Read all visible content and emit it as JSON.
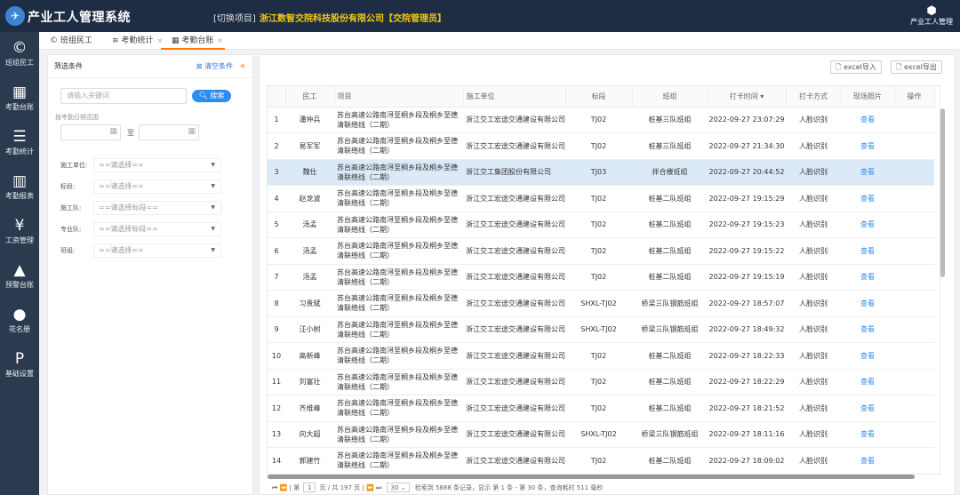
{
  "header": {
    "app_title": "产业工人管理系统",
    "switch_project": "[切换项目]",
    "company": "浙江数智交院科技股份有限公司【交院管理员】",
    "user_label": "产业工人管理"
  },
  "sidebar": {
    "items": [
      {
        "icon": "©",
        "label": "班组民工"
      },
      {
        "icon": "▦",
        "label": "考勤台账"
      },
      {
        "icon": "☰",
        "label": "考勤统计"
      },
      {
        "icon": "▥",
        "label": "考勤报表"
      },
      {
        "icon": "¥",
        "label": "工资管理"
      },
      {
        "icon": "▲",
        "label": "预警台账"
      },
      {
        "icon": "●",
        "label": "花名册"
      },
      {
        "icon": "P",
        "label": "基础设置"
      }
    ]
  },
  "tabs": [
    {
      "icon": "©",
      "label": "班组民工"
    },
    {
      "icon": "≡",
      "label": "考勤统计"
    },
    {
      "icon": "▦",
      "label": "考勤台账"
    }
  ],
  "filter": {
    "title": "筛选条件",
    "clear_label": "清空条件",
    "collapse_icon": "«",
    "keyword_placeholder": "请输入关键词",
    "search_label": "搜索",
    "date_range_label": "按考勤日期范围",
    "to_label": "至",
    "rows": [
      {
        "label": "施工单位:",
        "value": "==请选择=="
      },
      {
        "label": "标段:",
        "value": "==请选择=="
      },
      {
        "label": "施工队:",
        "value": "==请选择标段=="
      },
      {
        "label": "专业队:",
        "value": "==请选择标段=="
      },
      {
        "label": "班组:",
        "value": "==请选择=="
      }
    ]
  },
  "toolbar": {
    "import_label": "excel导入",
    "export_label": "excel导出"
  },
  "table": {
    "headers": [
      "",
      "民工",
      "项目",
      "施工单位",
      "标段",
      "班组",
      "打卡时间 ▾",
      "打卡方式",
      "现场照片",
      "操作"
    ],
    "rows": [
      {
        "no": "1",
        "name": "潘仲兵",
        "project": "苏台高速公路南浔至桐乡段及桐乡至德清联络线（二期）",
        "unit": "浙江交工宏途交通建设有限公司",
        "section": "TJ02",
        "team": "桩基三队班组",
        "time": "2022-09-27 23:07:29",
        "method": "人脸识别",
        "photo": "查看"
      },
      {
        "no": "2",
        "name": "易军军",
        "project": "苏台高速公路南浔至桐乡段及桐乡至德清联络线（二期）",
        "unit": "浙江交工宏途交通建设有限公司",
        "section": "TJ02",
        "team": "桩基三队班组",
        "time": "2022-09-27 21:34:30",
        "method": "人脸识别",
        "photo": "查看"
      },
      {
        "no": "3",
        "name": "魏仕",
        "project": "苏台高速公路南浔至桐乡段及桐乡至德清联络线（二期）",
        "unit": "浙江交工集团股份有限公司",
        "section": "TJ03",
        "team": "拌合楼班组",
        "time": "2022-09-27 20:44:52",
        "method": "人脸识别",
        "photo": "查看"
      },
      {
        "no": "4",
        "name": "赵龙波",
        "project": "苏台高速公路南浔至桐乡段及桐乡至德清联络线（二期）",
        "unit": "浙江交工宏途交通建设有限公司",
        "section": "TJ02",
        "team": "桩基二队班组",
        "time": "2022-09-27 19:15:29",
        "method": "人脸识别",
        "photo": "查看"
      },
      {
        "no": "5",
        "name": "汤孟",
        "project": "苏台高速公路南浔至桐乡段及桐乡至德清联络线（二期）",
        "unit": "浙江交工宏途交通建设有限公司",
        "section": "TJ02",
        "team": "桩基二队班组",
        "time": "2022-09-27 19:15:23",
        "method": "人脸识别",
        "photo": "查看"
      },
      {
        "no": "6",
        "name": "汤孟",
        "project": "苏台高速公路南浔至桐乡段及桐乡至德清联络线（二期）",
        "unit": "浙江交工宏途交通建设有限公司",
        "section": "TJ02",
        "team": "桩基二队班组",
        "time": "2022-09-27 19:15:22",
        "method": "人脸识别",
        "photo": "查看"
      },
      {
        "no": "7",
        "name": "汤孟",
        "project": "苏台高速公路南浔至桐乡段及桐乡至德清联络线（二期）",
        "unit": "浙江交工宏途交通建设有限公司",
        "section": "TJ02",
        "team": "桩基二队班组",
        "time": "2022-09-27 19:15:19",
        "method": "人脸识别",
        "photo": "查看"
      },
      {
        "no": "8",
        "name": "习贵斌",
        "project": "苏台高速公路南浔至桐乡段及桐乡至德清联络线（二期）",
        "unit": "浙江交工宏途交通建设有限公司",
        "section": "SHXL-TJ02",
        "team": "桥梁三队钢筋班组",
        "time": "2022-09-27 18:57:07",
        "method": "人脸识别",
        "photo": "查看"
      },
      {
        "no": "9",
        "name": "汪小树",
        "project": "苏台高速公路南浔至桐乡段及桐乡至德清联络线（二期）",
        "unit": "浙江交工宏途交通建设有限公司",
        "section": "SHXL-TJ02",
        "team": "桥梁三队钢筋班组",
        "time": "2022-09-27 18:49:32",
        "method": "人脸识别",
        "photo": "查看"
      },
      {
        "no": "10",
        "name": "高新峰",
        "project": "苏台高速公路南浔至桐乡段及桐乡至德清联络线（二期）",
        "unit": "浙江交工宏途交通建设有限公司",
        "section": "TJ02",
        "team": "桩基二队班组",
        "time": "2022-09-27 18:22:33",
        "method": "人脸识别",
        "photo": "查看"
      },
      {
        "no": "11",
        "name": "刘富壮",
        "project": "苏台高速公路南浔至桐乡段及桐乡至德清联络线（二期）",
        "unit": "浙江交工宏途交通建设有限公司",
        "section": "TJ02",
        "team": "桩基二队班组",
        "time": "2022-09-27 18:22:29",
        "method": "人脸识别",
        "photo": "查看"
      },
      {
        "no": "12",
        "name": "齐维峰",
        "project": "苏台高速公路南浔至桐乡段及桐乡至德清联络线（二期）",
        "unit": "浙江交工宏途交通建设有限公司",
        "section": "TJ02",
        "team": "桩基二队班组",
        "time": "2022-09-27 18:21:52",
        "method": "人脸识别",
        "photo": "查看"
      },
      {
        "no": "13",
        "name": "向大超",
        "project": "苏台高速公路南浔至桐乡段及桐乡至德清联络线（二期）",
        "unit": "浙江交工宏途交通建设有限公司",
        "section": "SHXL-TJ02",
        "team": "桥梁三队钢筋班组",
        "time": "2022-09-27 18:11:16",
        "method": "人脸识别",
        "photo": "查看"
      },
      {
        "no": "14",
        "name": "郭建竹",
        "project": "苏台高速公路南浔至桐乡段及桐乡至德清联络线（二期）",
        "unit": "浙江交工宏途交通建设有限公司",
        "section": "TJ02",
        "team": "桩基二队班组",
        "time": "2022-09-27 18:09:02",
        "method": "人脸识别",
        "photo": "查看"
      }
    ]
  },
  "pager": {
    "page_label": "第",
    "page_value": "1",
    "total_pages": "页 / 共 197 页",
    "page_size": "30",
    "summary": "检索到 5888 条记录，显示 第 1 条 - 第 30 条，查询耗时 511 毫秒"
  },
  "colors": {
    "topbar": "#1e2d44",
    "sidebar": "#2b3a4f",
    "accent": "#2d8cf0",
    "tab_active": "#ff7a00",
    "company": "#f2c811"
  }
}
